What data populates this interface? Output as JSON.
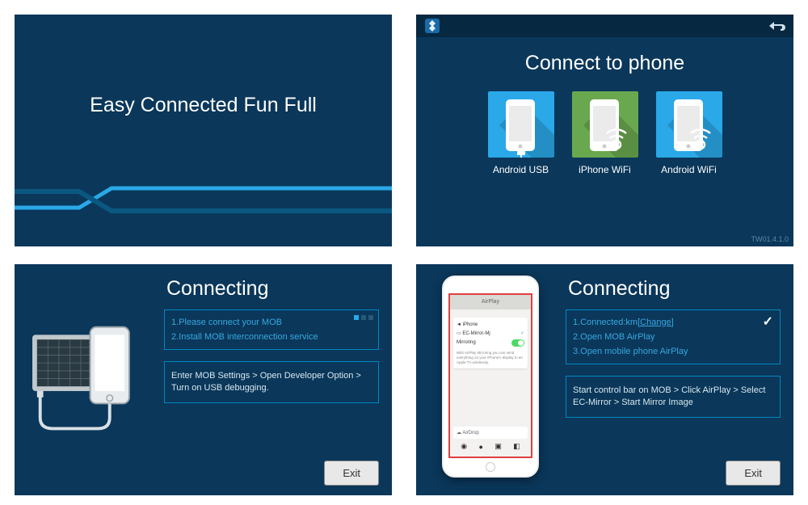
{
  "panel1": {
    "title": "Easy Connected Fun Full"
  },
  "panel2": {
    "title": "Connect to phone",
    "version": "TW01.4.1.0",
    "options": [
      {
        "label": "Android USB",
        "bg": "#2aa8e8",
        "icon": "usb"
      },
      {
        "label": "iPhone WiFi",
        "bg": "#6aa84f",
        "icon": "wifi"
      },
      {
        "label": "Android WiFi",
        "bg": "#2aa8e8",
        "icon": "wifi"
      }
    ]
  },
  "panel3": {
    "title": "Connecting",
    "steps": [
      "1.Please connect your MOB",
      "2.Install MOB interconnection service"
    ],
    "instruction": "Enter MOB Settings > Open Developer Option > Turn on USB debugging.",
    "exit": "Exit"
  },
  "panel4": {
    "title": "Connecting",
    "step1_prefix": "1.Connected:km",
    "step1_link": "[Change]",
    "steps_rest": [
      "2.Open MOB AirPlay",
      "3.Open mobile phone AirPlay"
    ],
    "instruction": "Start control bar on MOB > Click AirPlay > Select EC-Mirror > Start Mirror Image",
    "exit": "Exit",
    "airplay": {
      "header": "AirPlay",
      "row1": "iPhone",
      "row2": "EC-Mirror-Mj",
      "row3": "Mirroring",
      "note": "With AirPlay Mirroring you can send everything on your iPhone's display to an Apple TV wirelessly.",
      "airdrop": "AirDrop"
    }
  }
}
